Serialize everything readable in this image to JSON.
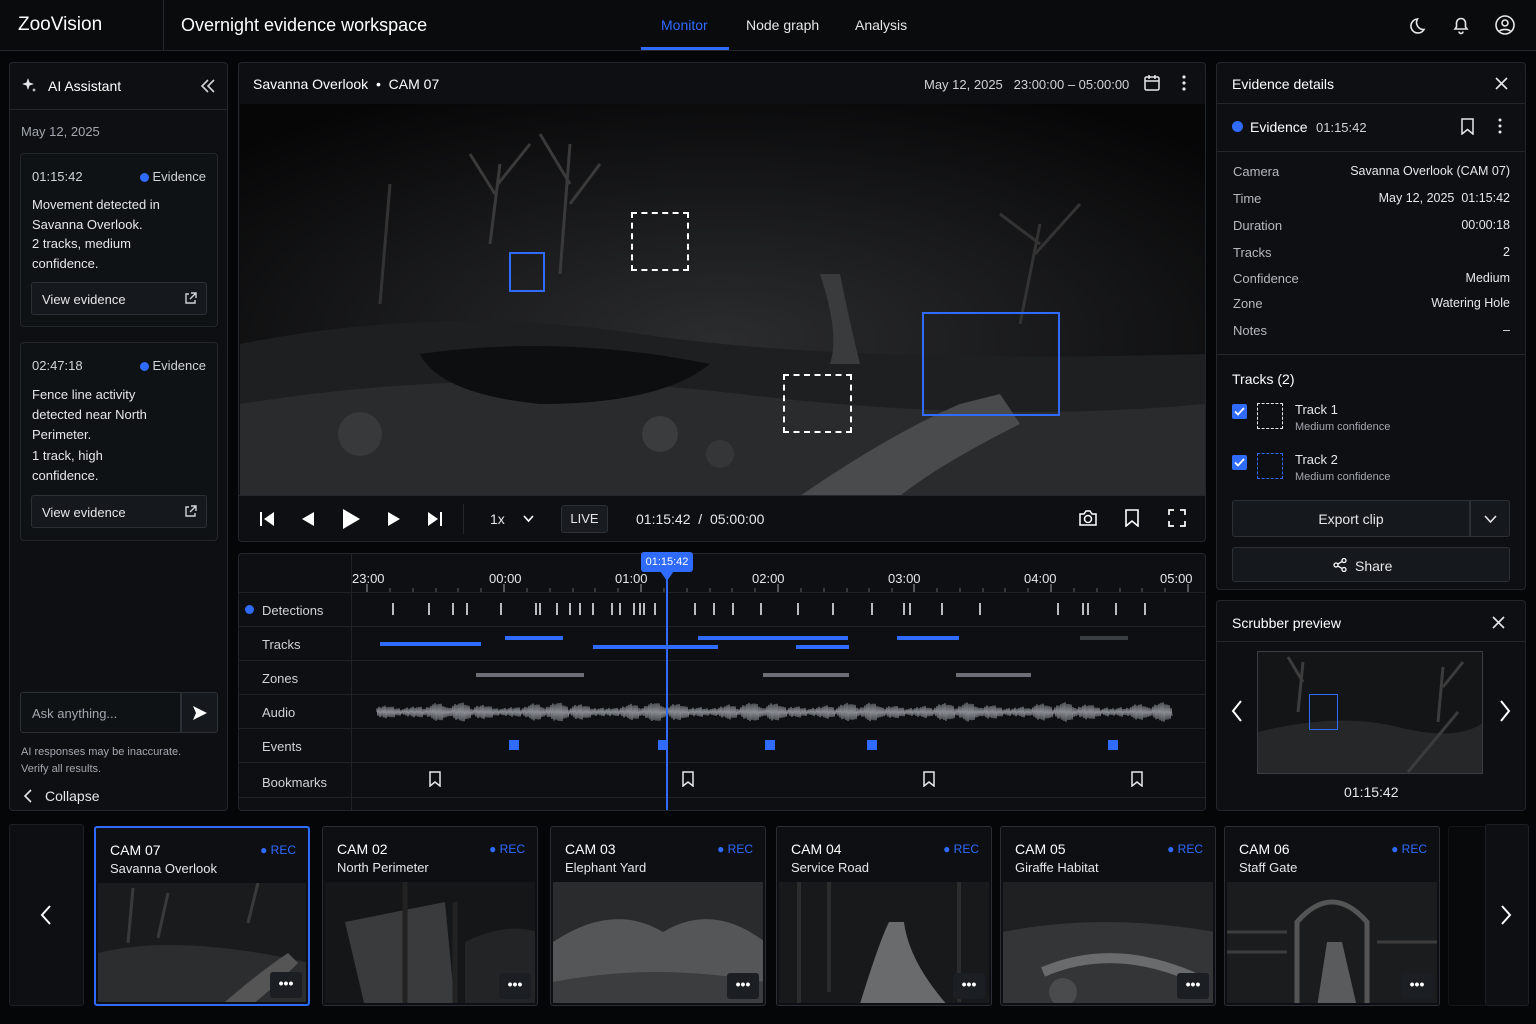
{
  "app": {
    "brand": "ZooVision",
    "workspace_title": "Overnight evidence workspace"
  },
  "nav": {
    "tabs": [
      {
        "label": "Monitor",
        "active": true
      },
      {
        "label": "Node graph"
      },
      {
        "label": "Analysis"
      }
    ]
  },
  "header_icons": [
    "moon-icon",
    "bell-icon",
    "user-icon"
  ],
  "ai_panel": {
    "title": "AI Assistant",
    "date": "May 12, 2025",
    "cards": [
      {
        "time": "01:15:42",
        "tag": "Evidence",
        "text": [
          "Movement detected in",
          "Savanna Overlook.",
          "2 tracks, medium",
          "confidence."
        ],
        "button": "View evidence"
      },
      {
        "time": "02:47:18",
        "tag": "Evidence",
        "text": [
          "Fence line activity",
          "detected near North",
          "Perimeter.",
          "1 track, high",
          "confidence."
        ],
        "button": "View evidence"
      }
    ],
    "input_placeholder": "Ask anything...",
    "disclaimer": [
      "AI responses may be inaccurate.",
      "Verify all results."
    ],
    "collapse_label": "Collapse"
  },
  "video": {
    "site": "Savanna Overlook",
    "separator": "•",
    "cam": "CAM 07",
    "date": "May 12, 2025",
    "range": "23:00:00 – 05:00:00",
    "speed": "1x",
    "live": "LIVE",
    "current": "01:15:42",
    "slash": "/",
    "total": "05:00:00"
  },
  "timeline": {
    "playhead": "01:15:42",
    "ticks": [
      "23:00",
      "00:00",
      "01:00",
      "02:00",
      "03:00",
      "04:00",
      "05:00"
    ],
    "rows": [
      "Detections",
      "Tracks",
      "Zones",
      "Audio",
      "Events",
      "Bookmarks"
    ]
  },
  "details": {
    "title": "Evidence details",
    "evidence_label": "Evidence",
    "evidence_time": "01:15:42",
    "fields": [
      {
        "k": "Camera",
        "v": "Savanna Overlook (CAM 07)"
      },
      {
        "k": "Time",
        "v": "May 12, 2025  01:15:42"
      },
      {
        "k": "Duration",
        "v": "00:00:18"
      },
      {
        "k": "Tracks",
        "v": "2"
      },
      {
        "k": "Confidence",
        "v": "Medium"
      },
      {
        "k": "Zone",
        "v": "Watering Hole"
      },
      {
        "k": "Notes",
        "v": "–"
      }
    ],
    "tracks_title": "Tracks (2)",
    "tracks": [
      {
        "name": "Track 1",
        "conf": "Medium confidence",
        "checked": true
      },
      {
        "name": "Track 2",
        "conf": "Medium confidence",
        "checked": true
      }
    ],
    "export_label": "Export clip",
    "share_label": "Share"
  },
  "scrubber": {
    "title": "Scrubber preview",
    "time": "01:15:42"
  },
  "cameras": [
    {
      "id": "CAM 07",
      "name": "Savanna Overlook",
      "rec": "REC",
      "selected": true
    },
    {
      "id": "CAM 02",
      "name": "North Perimeter",
      "rec": "REC"
    },
    {
      "id": "CAM 03",
      "name": "Elephant Yard",
      "rec": "REC"
    },
    {
      "id": "CAM 04",
      "name": "Service Road",
      "rec": "REC"
    },
    {
      "id": "CAM 05",
      "name": "Giraffe Habitat",
      "rec": "REC"
    },
    {
      "id": "CAM 06",
      "name": "Staff Gate",
      "rec": "REC"
    }
  ],
  "colors": {
    "accent": "#2f6bff",
    "bg": "#050607",
    "panel": "#0d0f12"
  }
}
